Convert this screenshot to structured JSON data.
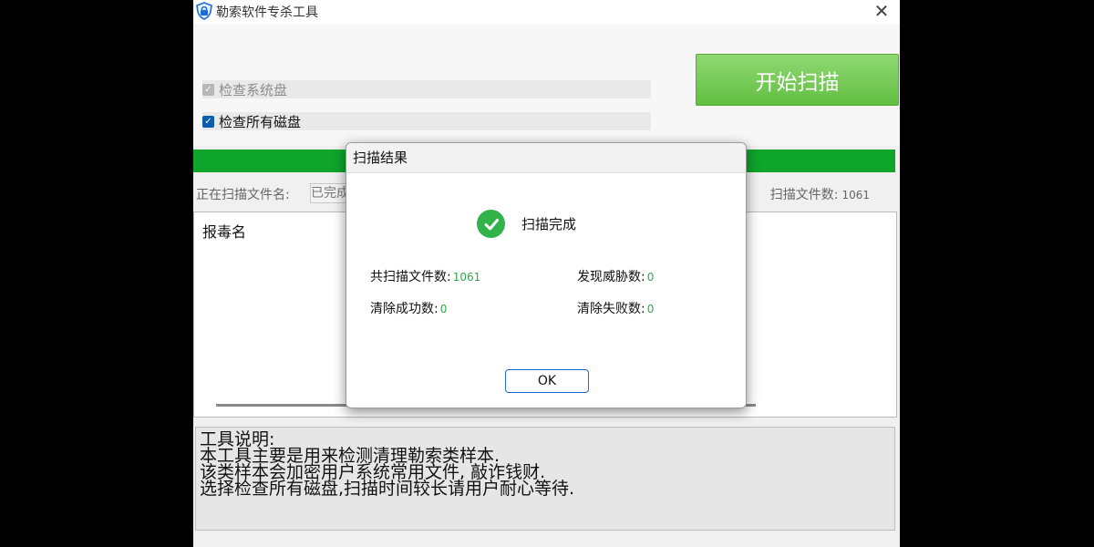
{
  "window": {
    "title": "勒索软件专杀工具",
    "close_glyph": "✕"
  },
  "options": [
    {
      "label": "检查系统盘",
      "checked": true,
      "disabled": true
    },
    {
      "label": "检查所有磁盘",
      "checked": true,
      "disabled": false
    }
  ],
  "start_button": {
    "label": "开始扫描"
  },
  "progress": {
    "fraction": 1.0,
    "color": "#0ea52a"
  },
  "scan_status": {
    "filename_label": "正在扫描文件名:",
    "filename_value": "已完成",
    "count_label": "扫描文件数:",
    "count_value": "1061"
  },
  "table": {
    "header": "报毒名"
  },
  "description": {
    "lines": [
      "工具说明:",
      "本工具主要是用来检测清理勒索类样本.",
      "该类样本会加密用户系统常用文件, 敲诈钱财.",
      "选择检查所有磁盘,扫描时间较长请用户耐心等待."
    ]
  },
  "dialog": {
    "title": "扫描结果",
    "status": "扫描完成",
    "stats": {
      "total_label": "共扫描文件数:",
      "total_value": "1061",
      "threats_label": "发现威胁数:",
      "threats_value": "0",
      "cleaned_label": "清除成功数:",
      "cleaned_value": "0",
      "failed_label": "清除失败数:",
      "failed_value": "0"
    },
    "ok_label": "OK"
  },
  "colors": {
    "accent_green": "#62bf41",
    "success": "#31b24b",
    "stat_number": "#2fa84a"
  },
  "icons": {
    "app": "shield-icon",
    "close": "close-icon",
    "status": "check-circle-icon"
  }
}
